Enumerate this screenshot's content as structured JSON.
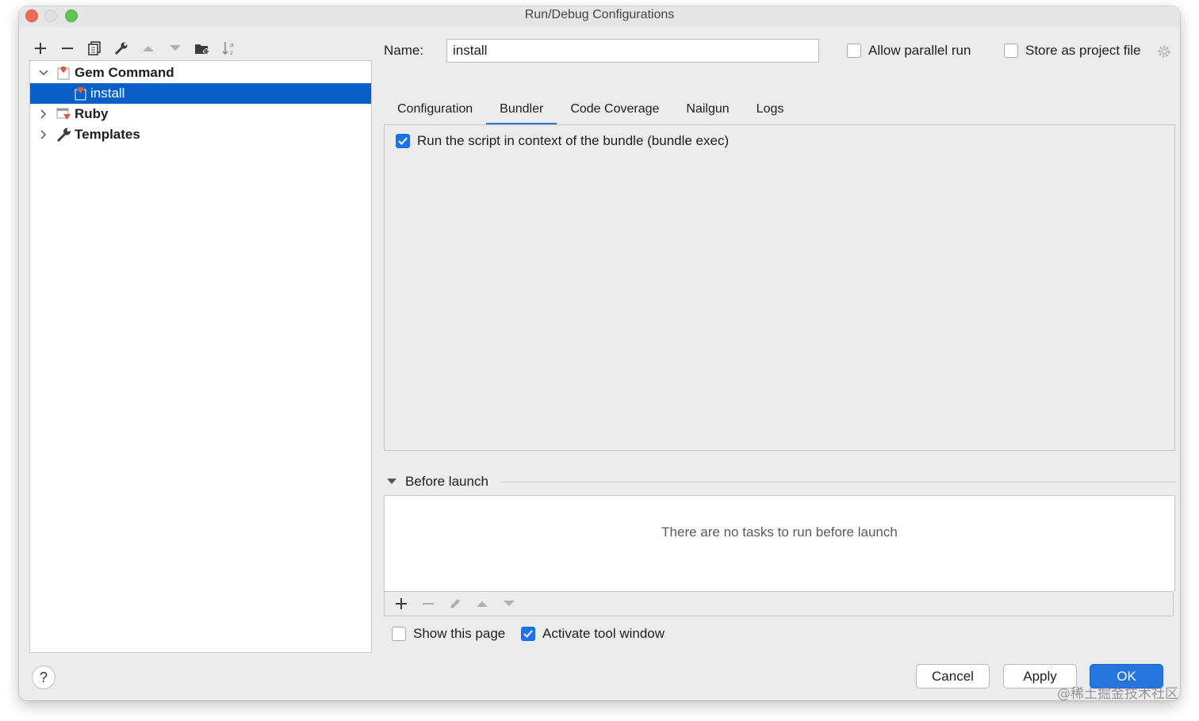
{
  "window": {
    "title": "Run/Debug Configurations"
  },
  "left_toolbar": {
    "icons": [
      "add-icon",
      "remove-icon",
      "copy-icon",
      "wrench-icon",
      "move-up-icon",
      "move-down-icon",
      "folder-add-icon",
      "sort-alpha-icon"
    ]
  },
  "tree": {
    "items": [
      {
        "label": "Gem Command",
        "expanded": true,
        "icon": "gem-command-icon"
      },
      {
        "label": "install",
        "selected": true,
        "icon": "gem-config-icon"
      },
      {
        "label": "Ruby",
        "expanded": false,
        "icon": "ruby-icon"
      },
      {
        "label": "Templates",
        "expanded": false,
        "icon": "wrench-icon"
      }
    ]
  },
  "name_field": {
    "label": "Name:",
    "value": "install"
  },
  "options": {
    "allow_parallel_run": {
      "label": "Allow parallel run",
      "checked": false
    },
    "store_as_project_file": {
      "label": "Store as project file",
      "checked": false
    }
  },
  "tabs": [
    {
      "label": "Configuration",
      "active": false
    },
    {
      "label": "Bundler",
      "active": true
    },
    {
      "label": "Code Coverage",
      "active": false
    },
    {
      "label": "Nailgun",
      "active": false
    },
    {
      "label": "Logs",
      "active": false
    }
  ],
  "bundler_panel": {
    "run_in_bundle_context": {
      "label": "Run the script in context of the bundle (bundle exec)",
      "checked": true
    }
  },
  "before_launch": {
    "title": "Before launch",
    "empty_text": "There are no tasks to run before launch",
    "toolbar_icons": [
      "add-icon",
      "remove-icon",
      "edit-icon",
      "move-up-icon",
      "move-down-icon"
    ]
  },
  "footer_options": {
    "show_this_page": {
      "label": "Show this page",
      "checked": false
    },
    "activate_tool_window": {
      "label": "Activate tool window",
      "checked": true
    }
  },
  "buttons": {
    "help": "?",
    "cancel": "Cancel",
    "apply": "Apply",
    "ok": "OK"
  },
  "watermark": "@稀土掘金技术社区",
  "colors": {
    "selection": "#0a5fc6",
    "accent": "#2674dd",
    "checkbox_on": "#1a73e8"
  }
}
